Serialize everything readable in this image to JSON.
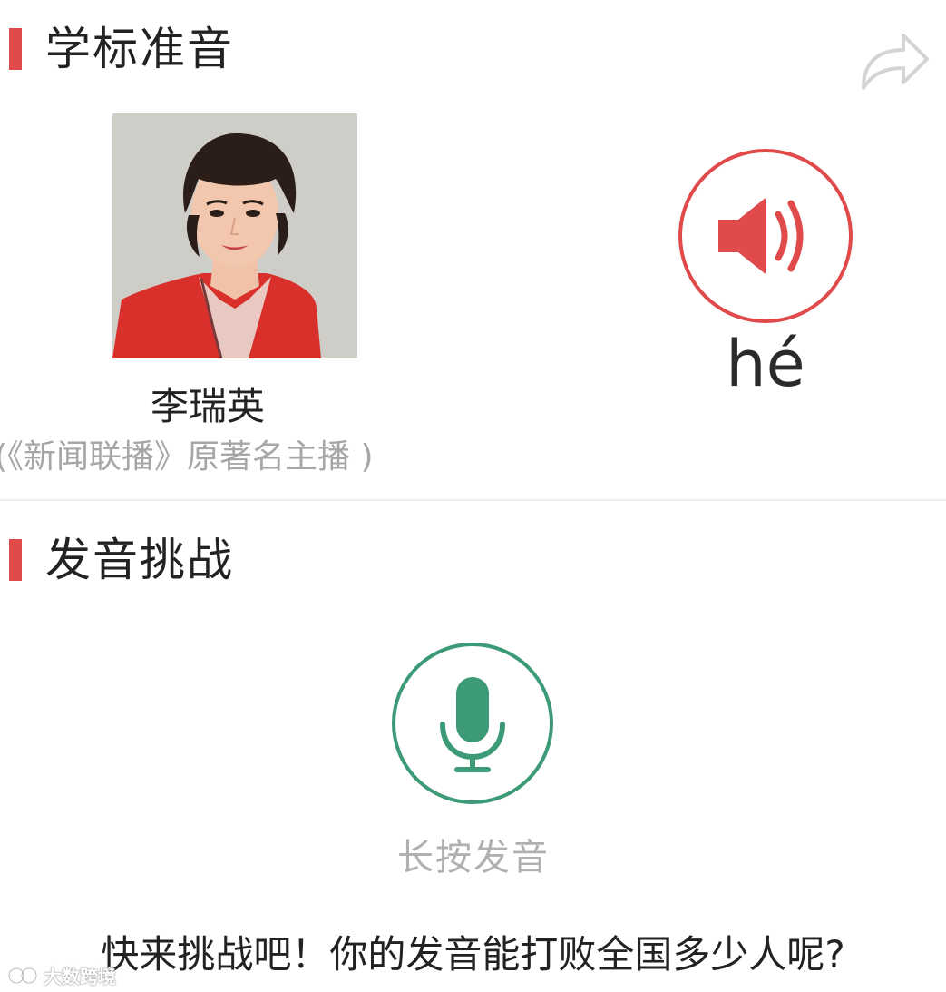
{
  "sections": {
    "standard": {
      "title": "学标准音"
    },
    "challenge": {
      "title": "发音挑战"
    }
  },
  "presenter": {
    "name": "李瑞英",
    "description": "(《新闻联播》原著名主播 )"
  },
  "pronunciation": {
    "pinyin": "hé"
  },
  "mic": {
    "label": "长按发音"
  },
  "challenge_prompt": "快来挑战吧！你的发音能打败全国多少人呢?",
  "watermark": {
    "text": "大数跨境"
  },
  "colors": {
    "accent_red": "#e04a4a",
    "mic_green": "#3c9a76",
    "muted_text": "#a6a6a6"
  },
  "icons": {
    "share": "share-arrow-icon",
    "speaker": "speaker-volume-icon",
    "mic": "microphone-icon"
  }
}
